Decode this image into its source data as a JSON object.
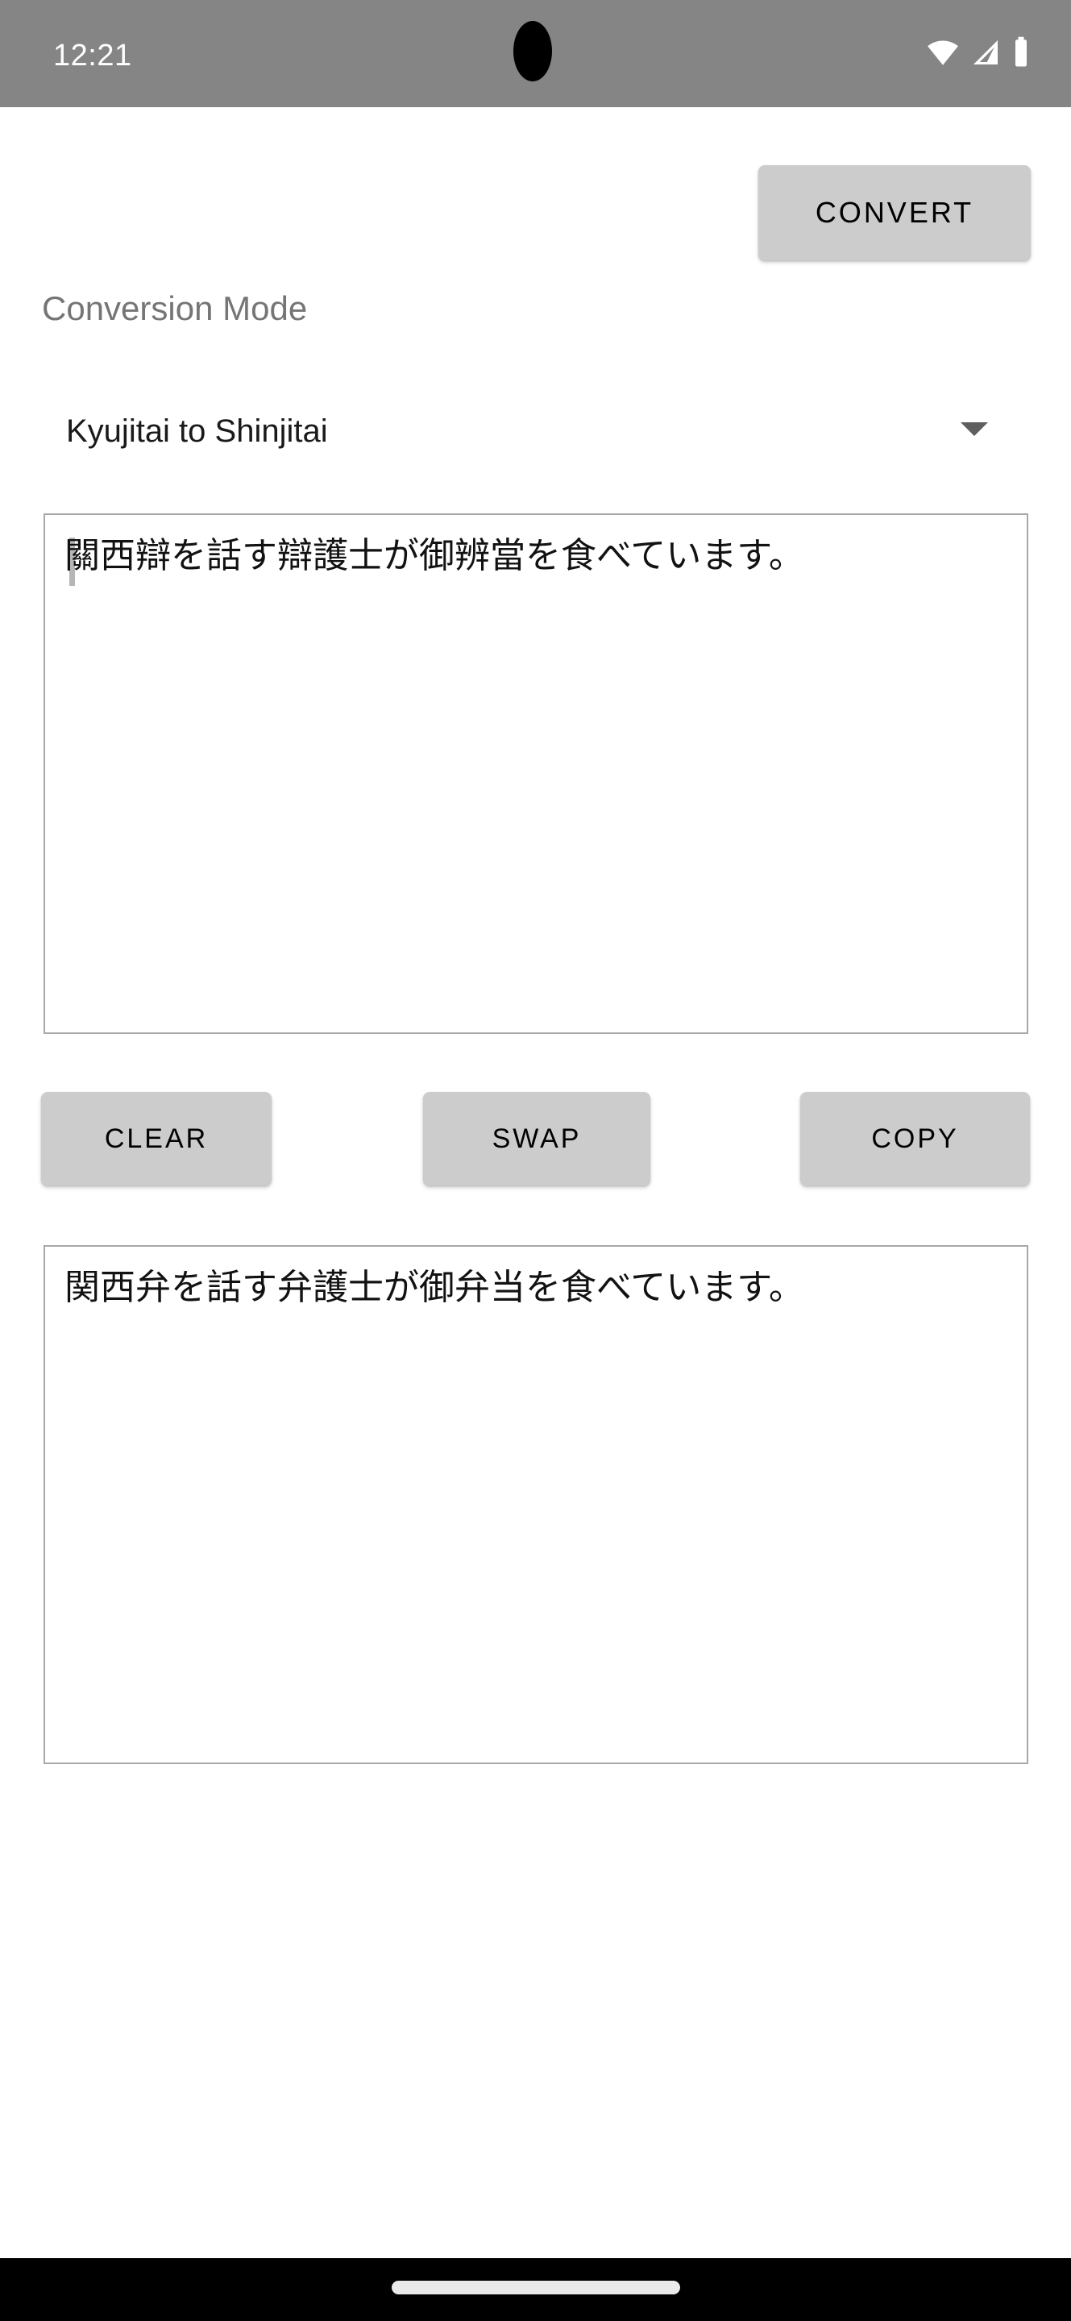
{
  "status_bar": {
    "time": "12:21",
    "icons": [
      "wifi-icon",
      "cellular-signal-icon",
      "battery-icon"
    ],
    "background_color": "#858585",
    "text_color": "#ffffff"
  },
  "toolbar": {
    "convert_label": "CONVERT"
  },
  "mode": {
    "label": "Conversion Mode",
    "selected": "Kyujitai to Shinjitai",
    "caret_icon": "chevron-down-icon"
  },
  "input": {
    "value": "關西辯を話す辯護士が御辨當を食べています。",
    "placeholder": ""
  },
  "output": {
    "value": "関西弁を話す弁護士が御弁当を食べています。",
    "placeholder": ""
  },
  "actions": {
    "clear_label": "CLEAR",
    "swap_label": "SWAP",
    "copy_label": "COPY"
  },
  "nav_bar": {
    "gesture_pill": "home-gesture-pill"
  },
  "colors": {
    "button_bg": "#cccccc",
    "button_text": "#000000",
    "label_gray": "#757575",
    "border_gray": "#a8a8a8",
    "status_bg": "#858585",
    "nav_bg": "#000000"
  }
}
